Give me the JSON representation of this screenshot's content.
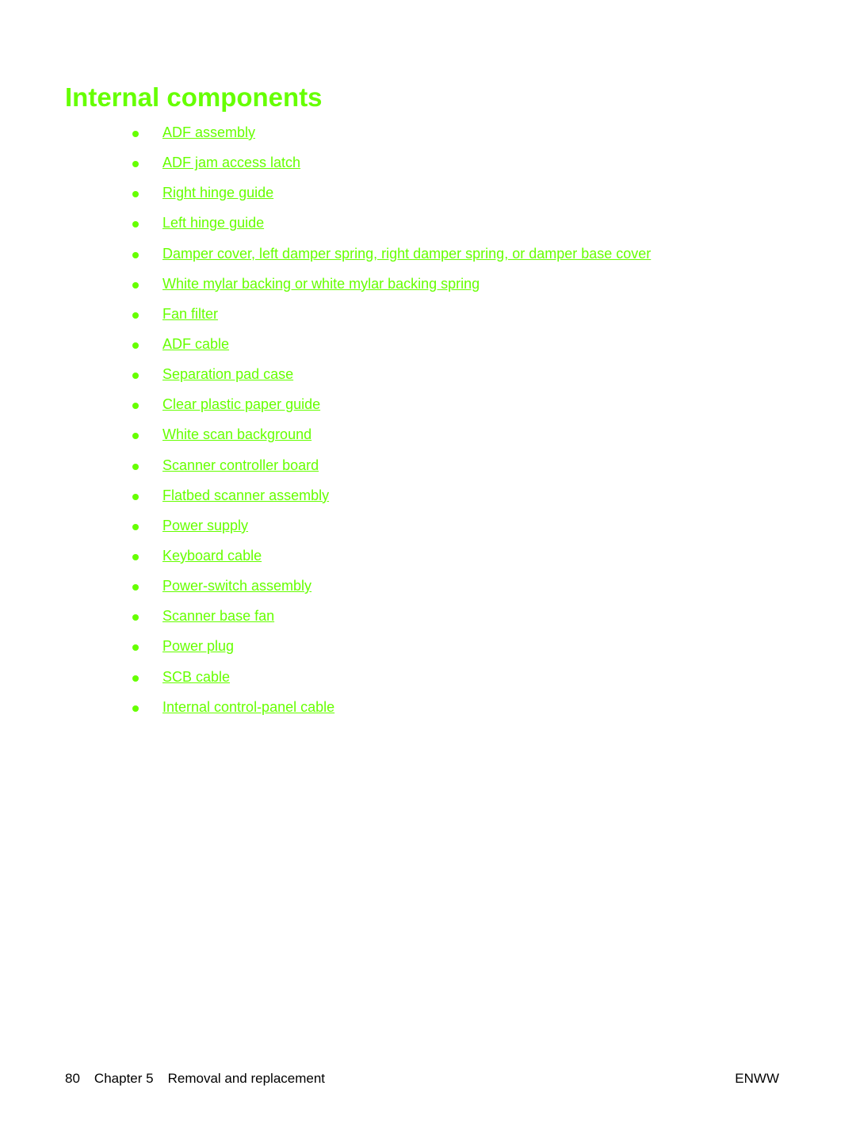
{
  "page": {
    "title": "Internal components",
    "accent_color": "#66ff00",
    "links": [
      "ADF assembly",
      "ADF jam access latch",
      "Right hinge guide",
      "Left hinge guide",
      "Damper cover, left damper spring, right damper spring, or damper base cover",
      "White mylar backing or white mylar backing spring",
      "Fan filter",
      "ADF cable",
      "Separation pad case",
      "Clear plastic paper guide",
      "White scan background",
      "Scanner controller board",
      "Flatbed scanner assembly",
      "Power supply",
      "Keyboard cable",
      "Power-switch assembly",
      "Scanner base fan",
      "Power plug",
      "SCB cable",
      "Internal control-panel cable"
    ]
  },
  "footer": {
    "page_number": "80",
    "chapter": "Chapter 5",
    "chapter_title": "Removal and replacement",
    "right_label": "ENWW"
  }
}
